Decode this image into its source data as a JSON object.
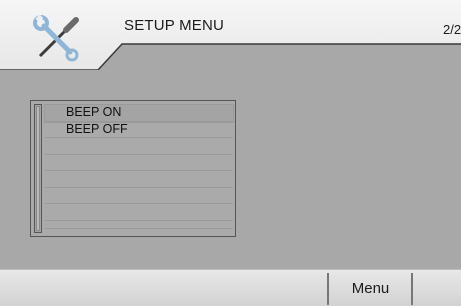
{
  "header": {
    "title": "SETUP MENU",
    "page_indicator": "2/2",
    "icon": "wrench-screwdriver-icon"
  },
  "list": {
    "items": [
      {
        "label": "BEEP ON",
        "selected": true
      },
      {
        "label": "BEEP OFF",
        "selected": false
      }
    ]
  },
  "footer": {
    "menu_label": "Menu"
  },
  "colors": {
    "background": "#a8a8a8",
    "header": "#efefef",
    "footer": "#dcdcdc"
  }
}
